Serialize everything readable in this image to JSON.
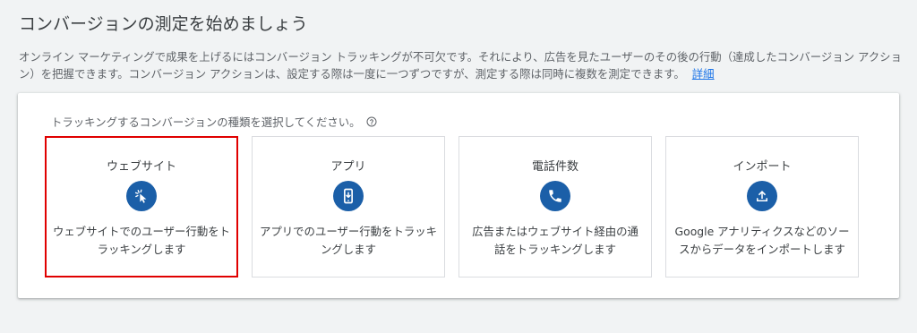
{
  "page": {
    "title": "コンバージョンの測定を始めましょう",
    "description": "オンライン マーケティングで成果を上げるにはコンバージョン トラッキングが不可欠です。それにより、広告を見たユーザーのその後の行動（達成したコンバージョン アクション）を把握できます。コンバージョン アクションは、設定する際は一度に一つずつですが、測定する際は同時に複数を測定できます。",
    "details_link": "詳細"
  },
  "selector": {
    "prompt": "トラッキングするコンバージョンの種類を選択してください。",
    "help_icon": "help-circle-icon",
    "options": [
      {
        "title": "ウェブサイト",
        "icon": "cursor-click-icon",
        "description": "ウェブサイトでのユーザー行動をトラッキングします",
        "selected": true
      },
      {
        "title": "アプリ",
        "icon": "mobile-download-icon",
        "description": "アプリでのユーザー行動をトラッキングします",
        "selected": false
      },
      {
        "title": "電話件数",
        "icon": "phone-icon",
        "description": "広告またはウェブサイト経由の通話をトラッキングします",
        "selected": false
      },
      {
        "title": "インポート",
        "icon": "upload-icon",
        "description": "Google アナリティクスなどのソースからデータをインポートします",
        "selected": false
      }
    ]
  },
  "colors": {
    "icon_circle": "#1b5fa8",
    "selected_border": "#e00000",
    "link": "#1a73e8"
  }
}
